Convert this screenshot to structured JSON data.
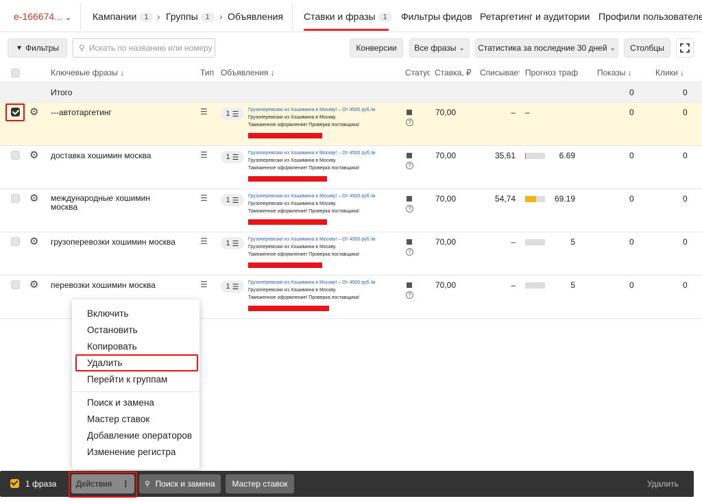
{
  "nav": {
    "account": "e-166674...",
    "breadcrumbs": [
      {
        "label": "Кампании",
        "count": "1"
      },
      {
        "label": "Группы",
        "count": "1"
      },
      {
        "label": "Объявления"
      }
    ],
    "tabs": [
      {
        "label": "Ставки и фразы",
        "count": "1",
        "active": true
      },
      {
        "label": "Фильтры фидов"
      },
      {
        "label": "Ретаргетинг и аудитории"
      },
      {
        "label": "Профили пользователей"
      }
    ]
  },
  "toolbar": {
    "filters": "Фильтры",
    "search_placeholder": "Искать по названию или номеру",
    "conversions": "Конверсии",
    "phrases": "Все фразы",
    "stats": "Статистика за последние 30 дней",
    "columns": "Столбцы"
  },
  "columns": {
    "keywords": "Ключевые фразы",
    "type": "Тип",
    "ads": "Объявления",
    "status": "Статус",
    "bid": "Ставка, ₽",
    "charged": "Списывает",
    "forecast": "Прогноз трафи",
    "impressions": "Показы",
    "clicks": "Клики"
  },
  "total": {
    "label": "Итого",
    "impressions": "0",
    "clicks": "0"
  },
  "ad_text": {
    "title": "Грузоперевозки из Хошимина в Москву! – От 4500 руб./м",
    "line1": "Грузоперевозки из Хошимина в Москву.",
    "line2": "Таможенное оформление! Проверка поставщика!"
  },
  "rows": [
    {
      "phrase": "---автотаргетинг",
      "ads_count": "1",
      "bid": "70,00",
      "charged": "–",
      "forecast": "–",
      "forecast_pct": null,
      "impressions": "0",
      "clicks": "0",
      "selected": true
    },
    {
      "phrase": "доставка хошимин москва",
      "ads_count": "1",
      "bid": "70,00",
      "charged": "35,61",
      "forecast": "6.69",
      "forecast_pct": 0.05,
      "forecast_color": "#e05566",
      "impressions": "0",
      "clicks": "0",
      "selected": false
    },
    {
      "phrase": "международные хошимин москва",
      "ads_count": "1",
      "bid": "70,00",
      "charged": "54,74",
      "forecast": "69.19",
      "forecast_pct": 0.55,
      "forecast_color": "#f5b11a",
      "impressions": "0",
      "clicks": "0",
      "selected": false
    },
    {
      "phrase": "грузоперевозки хошимин москва",
      "ads_count": "1",
      "bid": "70,00",
      "charged": "–",
      "forecast": "5",
      "forecast_pct": 0,
      "forecast_color": "#ddd",
      "impressions": "0",
      "clicks": "0",
      "selected": false
    },
    {
      "phrase": "перевозки хошимин москва",
      "ads_count": "1",
      "bid": "70,00",
      "charged": "–",
      "forecast": "5",
      "forecast_pct": 0,
      "forecast_color": "#ddd",
      "impressions": "0",
      "clicks": "0",
      "selected": false
    }
  ],
  "menu": {
    "group1": [
      "Включить",
      "Остановить",
      "Копировать",
      "Удалить",
      "Перейти к группам"
    ],
    "group2": [
      "Поиск и замена",
      "Мастер ставок",
      "Добавление операторов",
      "Изменение регистра"
    ]
  },
  "bottom": {
    "selected": "1 фраза",
    "actions": "Действия",
    "search_replace": "Поиск и замена",
    "bid_master": "Мастер ставок",
    "delete": "Удалить"
  },
  "colors": {
    "accent": "#e42a2a",
    "highlight_row": "#fff8dc",
    "link": "#2c5fb5",
    "bottom_bar": "#333333"
  }
}
